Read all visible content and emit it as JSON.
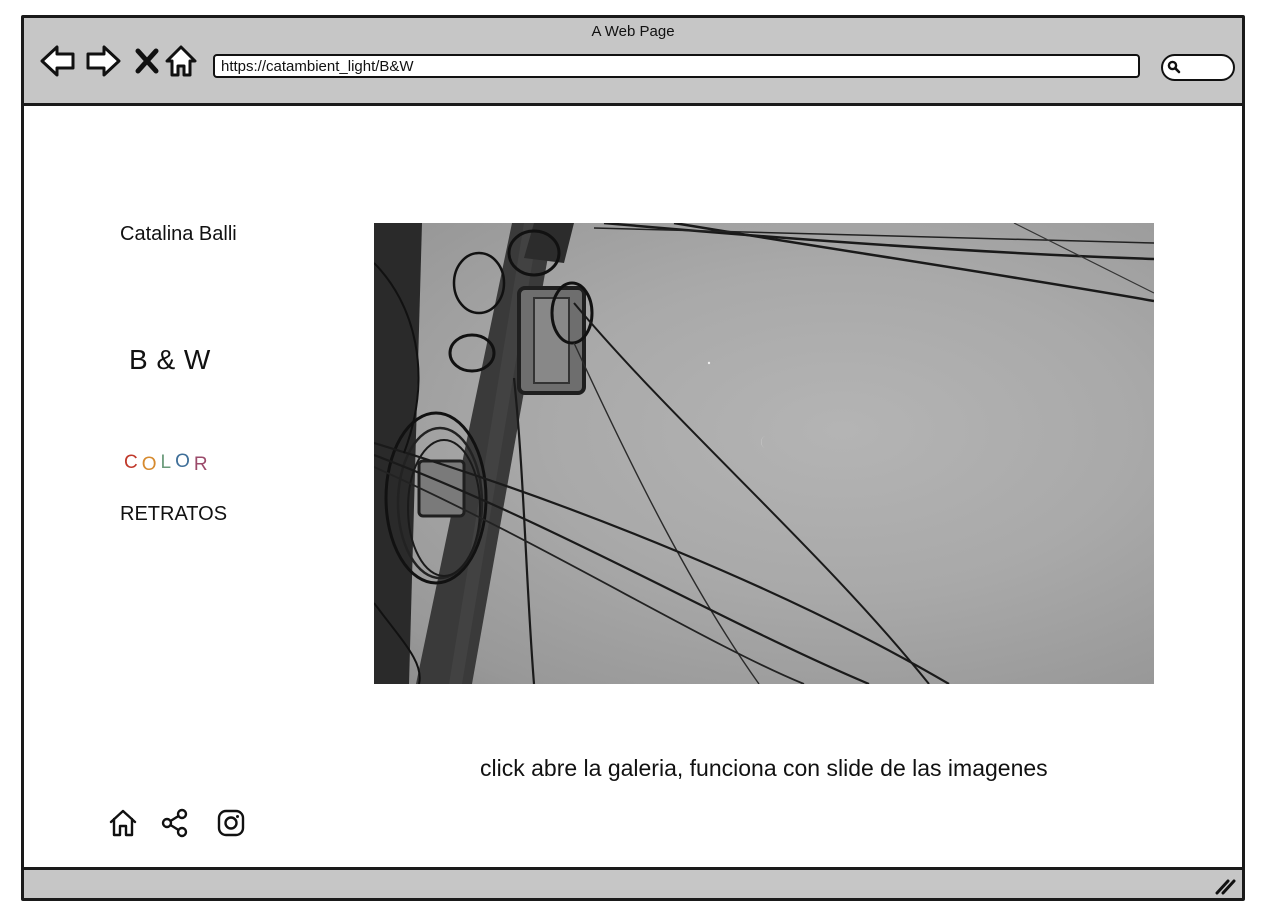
{
  "window": {
    "title": "A Web Page"
  },
  "browser": {
    "url": "https://catambient_light/B&W",
    "icons": [
      "back-arrow-icon",
      "forward-arrow-icon",
      "close-icon",
      "home-icon",
      "search-icon"
    ]
  },
  "sidebar": {
    "author": "Catalina Balli",
    "nav_bw": "B & W",
    "nav_color_letters": [
      "C",
      "O",
      "L",
      "O",
      "R"
    ],
    "nav_color_colors": [
      "#c0392b",
      "#d68a2e",
      "#6a9a7a",
      "#3f6f99",
      "#9b4a6a"
    ],
    "nav_retratos": "RETRATOS"
  },
  "main": {
    "photo_icon": "photo-power-pole-bw",
    "caption": "click abre la galeria, funciona con slide de las imagenes"
  },
  "footer": {
    "icons": [
      "home-icon",
      "share-icon",
      "instagram-icon"
    ]
  }
}
